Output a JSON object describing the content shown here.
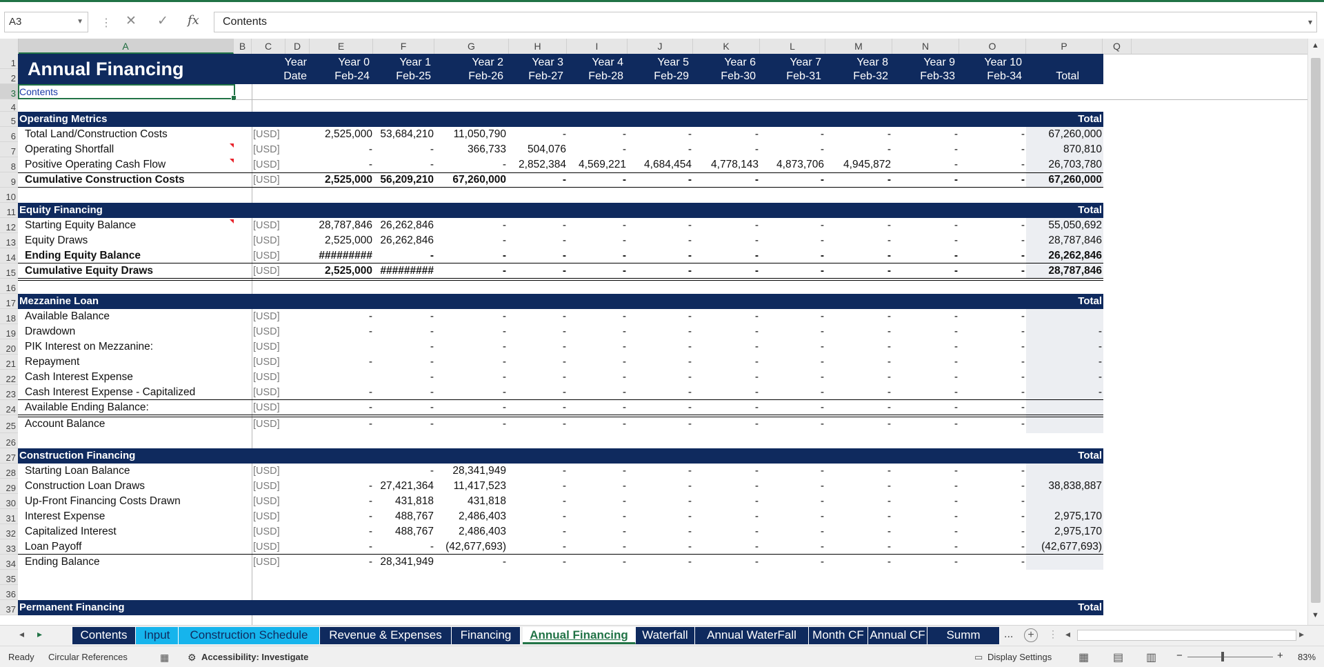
{
  "formula_bar": {
    "name_box": "A3",
    "content": "Contents"
  },
  "columns": [
    "A",
    "B",
    "C",
    "D",
    "E",
    "F",
    "G",
    "H",
    "I",
    "J",
    "K",
    "L",
    "M",
    "N",
    "O",
    "P",
    "Q"
  ],
  "header": {
    "title": "Annual Financing",
    "year_labels": [
      "Year",
      "Year 0",
      "Year 1",
      "Year 2",
      "Year 3",
      "Year 4",
      "Year 5",
      "Year 6",
      "Year 7",
      "Year 8",
      "Year 9",
      "Year 10"
    ],
    "date_labels": [
      "Date",
      "Feb-24",
      "Feb-25",
      "Feb-26",
      "Feb-27",
      "Feb-28",
      "Feb-29",
      "Feb-30",
      "Feb-31",
      "Feb-32",
      "Feb-33",
      "Feb-34",
      "Total"
    ],
    "contents_link": "Contents"
  },
  "unit": "[USD]",
  "rows": [
    {
      "n": "1"
    },
    {
      "n": "2"
    },
    {
      "n": "3"
    },
    {
      "n": "4"
    },
    {
      "n": "5",
      "section": "Operating Metrics",
      "total": "Total"
    },
    {
      "n": "6",
      "label": "Total Land/Construction Costs",
      "unit": true,
      "vals": [
        "2,525,000",
        "53,684,210",
        "11,050,790",
        "-",
        "-",
        "-",
        "-",
        "-",
        "-",
        "-",
        "-"
      ],
      "total": "67,260,000"
    },
    {
      "n": "7",
      "label": "Operating Shortfall",
      "unit": true,
      "vals": [
        "-",
        "-",
        "366,733",
        "504,076",
        "-",
        "-",
        "-",
        "-",
        "-",
        "-",
        "-"
      ],
      "total": "870,810"
    },
    {
      "n": "8",
      "label": "Positive Operating Cash Flow",
      "unit": true,
      "vals": [
        "-",
        "-",
        "-",
        "2,852,384",
        "4,569,221",
        "4,684,454",
        "4,778,143",
        "4,873,706",
        "4,945,872",
        "-",
        "-"
      ],
      "total": "26,703,780"
    },
    {
      "n": "9",
      "label": "Cumulative Construction Costs",
      "bold": true,
      "unit": true,
      "vals": [
        "2,525,000",
        "56,209,210",
        "67,260,000",
        "-",
        "-",
        "-",
        "-",
        "-",
        "-",
        "-",
        "-"
      ],
      "total": "67,260,000",
      "totbold": true
    },
    {
      "n": "10"
    },
    {
      "n": "11",
      "section": "Equity Financing",
      "total": "Total"
    },
    {
      "n": "12",
      "label": "Starting Equity Balance",
      "unit": true,
      "vals": [
        "28,787,846",
        "26,262,846",
        "-",
        "-",
        "-",
        "-",
        "-",
        "-",
        "-",
        "-",
        "-"
      ],
      "total": "55,050,692"
    },
    {
      "n": "13",
      "label": "Equity Draws",
      "unit": true,
      "vals": [
        "2,525,000",
        "26,262,846",
        "-",
        "-",
        "-",
        "-",
        "-",
        "-",
        "-",
        "-",
        "-"
      ],
      "total": "28,787,846"
    },
    {
      "n": "14",
      "label": "Ending Equity Balance",
      "bold": true,
      "unit": true,
      "vals": [
        "#########",
        "-",
        "-",
        "-",
        "-",
        "-",
        "-",
        "-",
        "-",
        "-",
        "-"
      ],
      "total": "26,262,846",
      "totbold": true
    },
    {
      "n": "15",
      "label": "Cumulative Equity Draws",
      "bold": true,
      "unit": true,
      "vals": [
        "2,525,000",
        "#########",
        "-",
        "-",
        "-",
        "-",
        "-",
        "-",
        "-",
        "-",
        "-"
      ],
      "total": "28,787,846",
      "totbold": true
    },
    {
      "n": "16"
    },
    {
      "n": "17",
      "section": "Mezzanine Loan",
      "total": "Total"
    },
    {
      "n": "18",
      "label": "Available Balance",
      "unit": true,
      "vals": [
        "-",
        "-",
        "-",
        "-",
        "-",
        "-",
        "-",
        "-",
        "-",
        "-",
        "-"
      ],
      "total": ""
    },
    {
      "n": "19",
      "label": "Drawdown",
      "unit": true,
      "vals": [
        "-",
        "-",
        "-",
        "-",
        "-",
        "-",
        "-",
        "-",
        "-",
        "-",
        "-"
      ],
      "total": "-"
    },
    {
      "n": "20",
      "label": "PIK Interest on Mezzanine:",
      "unit": true,
      "vals": [
        "",
        "-",
        "-",
        "-",
        "-",
        "-",
        "-",
        "-",
        "-",
        "-",
        "-"
      ],
      "total": "-"
    },
    {
      "n": "21",
      "label": "Repayment",
      "unit": true,
      "vals": [
        "-",
        "-",
        "-",
        "-",
        "-",
        "-",
        "-",
        "-",
        "-",
        "-",
        "-"
      ],
      "total": "-"
    },
    {
      "n": "22",
      "label": "Cash Interest Expense",
      "unit": true,
      "vals": [
        "",
        "-",
        "-",
        "-",
        "-",
        "-",
        "-",
        "-",
        "-",
        "-",
        "-"
      ],
      "total": "-"
    },
    {
      "n": "23",
      "label": "Cash Interest Expense - Capitalized",
      "unit": true,
      "vals": [
        "-",
        "-",
        "-",
        "-",
        "-",
        "-",
        "-",
        "-",
        "-",
        "-",
        "-"
      ],
      "total": "-"
    },
    {
      "n": "24",
      "label": "Available Ending Balance:",
      "unit": true,
      "vals": [
        "-",
        "-",
        "-",
        "-",
        "-",
        "-",
        "-",
        "-",
        "-",
        "-",
        "-"
      ],
      "total": ""
    },
    {
      "n": "25",
      "label": "Account Balance",
      "unit": true,
      "vals": [
        "-",
        "-",
        "-",
        "-",
        "-",
        "-",
        "-",
        "-",
        "-",
        "-",
        "-"
      ],
      "total": ""
    },
    {
      "n": "26"
    },
    {
      "n": "27",
      "section": "Construction Financing",
      "total": "Total"
    },
    {
      "n": "28",
      "label": "Starting Loan Balance",
      "unit": true,
      "vals": [
        "",
        "-",
        "28,341,949",
        "-",
        "-",
        "-",
        "-",
        "-",
        "-",
        "-",
        "-"
      ],
      "total": ""
    },
    {
      "n": "29",
      "label": "Construction Loan Draws",
      "unit": true,
      "vals": [
        "-",
        "27,421,364",
        "11,417,523",
        "-",
        "-",
        "-",
        "-",
        "-",
        "-",
        "-",
        "-"
      ],
      "total": "38,838,887"
    },
    {
      "n": "30",
      "label": "Up-Front Financing Costs Drawn",
      "unit": true,
      "vals": [
        "-",
        "431,818",
        "431,818",
        "-",
        "-",
        "-",
        "-",
        "-",
        "-",
        "-",
        "-"
      ],
      "total": ""
    },
    {
      "n": "31",
      "label": "Interest Expense",
      "unit": true,
      "vals": [
        "-",
        "488,767",
        "2,486,403",
        "-",
        "-",
        "-",
        "-",
        "-",
        "-",
        "-",
        "-"
      ],
      "total": "2,975,170"
    },
    {
      "n": "32",
      "label": "Capitalized Interest",
      "unit": true,
      "vals": [
        "-",
        "488,767",
        "2,486,403",
        "-",
        "-",
        "-",
        "-",
        "-",
        "-",
        "-",
        "-"
      ],
      "total": "2,975,170"
    },
    {
      "n": "33",
      "label": "Loan Payoff",
      "unit": true,
      "vals": [
        "-",
        "-",
        "(42,677,693)",
        "-",
        "-",
        "-",
        "-",
        "-",
        "-",
        "-",
        "-"
      ],
      "total": "(42,677,693)"
    },
    {
      "n": "34",
      "label": "Ending Balance",
      "unit": true,
      "vals": [
        "-",
        "28,341,949",
        "-",
        "-",
        "-",
        "-",
        "-",
        "-",
        "-",
        "-",
        "-"
      ],
      "total": ""
    },
    {
      "n": "35"
    },
    {
      "n": "36"
    },
    {
      "n": "37",
      "section": "Permanent Financing",
      "total": "Total"
    }
  ],
  "tabs": [
    {
      "label": "Contents",
      "style": "navy"
    },
    {
      "label": "Input",
      "style": "cyan"
    },
    {
      "label": "Construction Schedule",
      "style": "cyan"
    },
    {
      "label": "Revenue & Expenses",
      "style": "navy"
    },
    {
      "label": "Financing",
      "style": "navy"
    },
    {
      "label": "Annual Financing",
      "style": "active"
    },
    {
      "label": "Waterfall",
      "style": "navy"
    },
    {
      "label": "Annual WaterFall",
      "style": "navy"
    },
    {
      "label": "Month CF",
      "style": "navy"
    },
    {
      "label": "Annual CF",
      "style": "navy"
    },
    {
      "label": "Summ",
      "style": "navy"
    }
  ],
  "tab_more": "...",
  "status": {
    "ready": "Ready",
    "circular": "Circular References",
    "accessibility": "Accessibility: Investigate",
    "display_settings": "Display Settings",
    "zoom": "83%"
  },
  "colors": {
    "navy": "#0f2a5e",
    "cyan": "#16b4ec",
    "excel_green": "#217346"
  }
}
